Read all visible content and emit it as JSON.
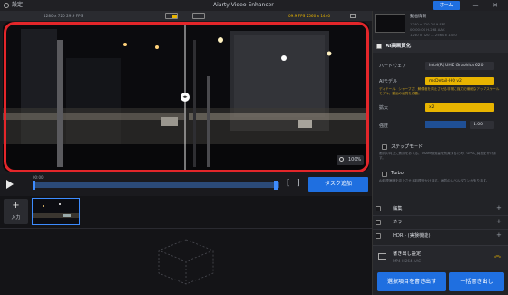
{
  "titlebar": {
    "settings_label": "設定",
    "app_title": "Aiarty Video Enhancer",
    "home_label": "ホーム",
    "minimize": "—",
    "close": "✕"
  },
  "preview": {
    "left_info": "1280 x 720  29.9 FPS",
    "right_info": "09.9 FPS  2560 x 1440",
    "zoom": "100%"
  },
  "timeline": {
    "timecode": "00:00",
    "task_add_label": "タスク追加",
    "bracket_in": "[",
    "bracket_out": "]"
  },
  "clips": {
    "add_label": "入力",
    "add_icon": "+"
  },
  "right": {
    "video_info_title": "動画情報",
    "video_info_lines": [
      "1280 x 720  29.9 FPS",
      "00:00:00  H.264  AAC",
      "1280 x 720 … 2560 x 1440"
    ],
    "ai_section_title": "AI高画質化",
    "hardware_label": "ハードウェア",
    "hardware_value": "Intel(R) UHD Graphics 620",
    "ai_model_label": "AIモデル",
    "ai_model_value": "moDetail-HQ  v2",
    "ai_model_desc": "ディテール、シャープさ、解像度を向上させる非常に強力で繊細なアップスケールモデル、動画の画質を改善。",
    "scale_label": "拡大",
    "scale_value": "x2",
    "strength_label": "強度",
    "strength_value": "1.00",
    "stepmode_label": "ステップモード",
    "stepmode_desc": "画質の向上に焦点をあてる、VRAM使用量を削減するため、GPUに負担をかけます。",
    "turbo_label": "Turbo",
    "turbo_desc": "AI処理速度を向上させる処理をかけます。画質のレベルダウンがあります。",
    "sections": [
      {
        "label": "編集"
      },
      {
        "label": "カラー"
      },
      {
        "label": "HDR - (実験機能)"
      }
    ],
    "export_settings_title": "書き出し設定",
    "export_settings_sub": "MP4  H.264  AAC",
    "export_selected_label": "選択項目を書き出す",
    "export_all_label": "一括書き出し"
  },
  "colors": {
    "accent": "#1f6fe0",
    "highlight_red": "#e3262a",
    "model_yellow": "#e8b400"
  },
  "icons": [
    "gear-icon",
    "play-icon",
    "zoom-icon",
    "split-handle-icon",
    "checkbox-icon",
    "plus-icon",
    "chevron-up-icon",
    "export-icon",
    "add-media-icon"
  ]
}
